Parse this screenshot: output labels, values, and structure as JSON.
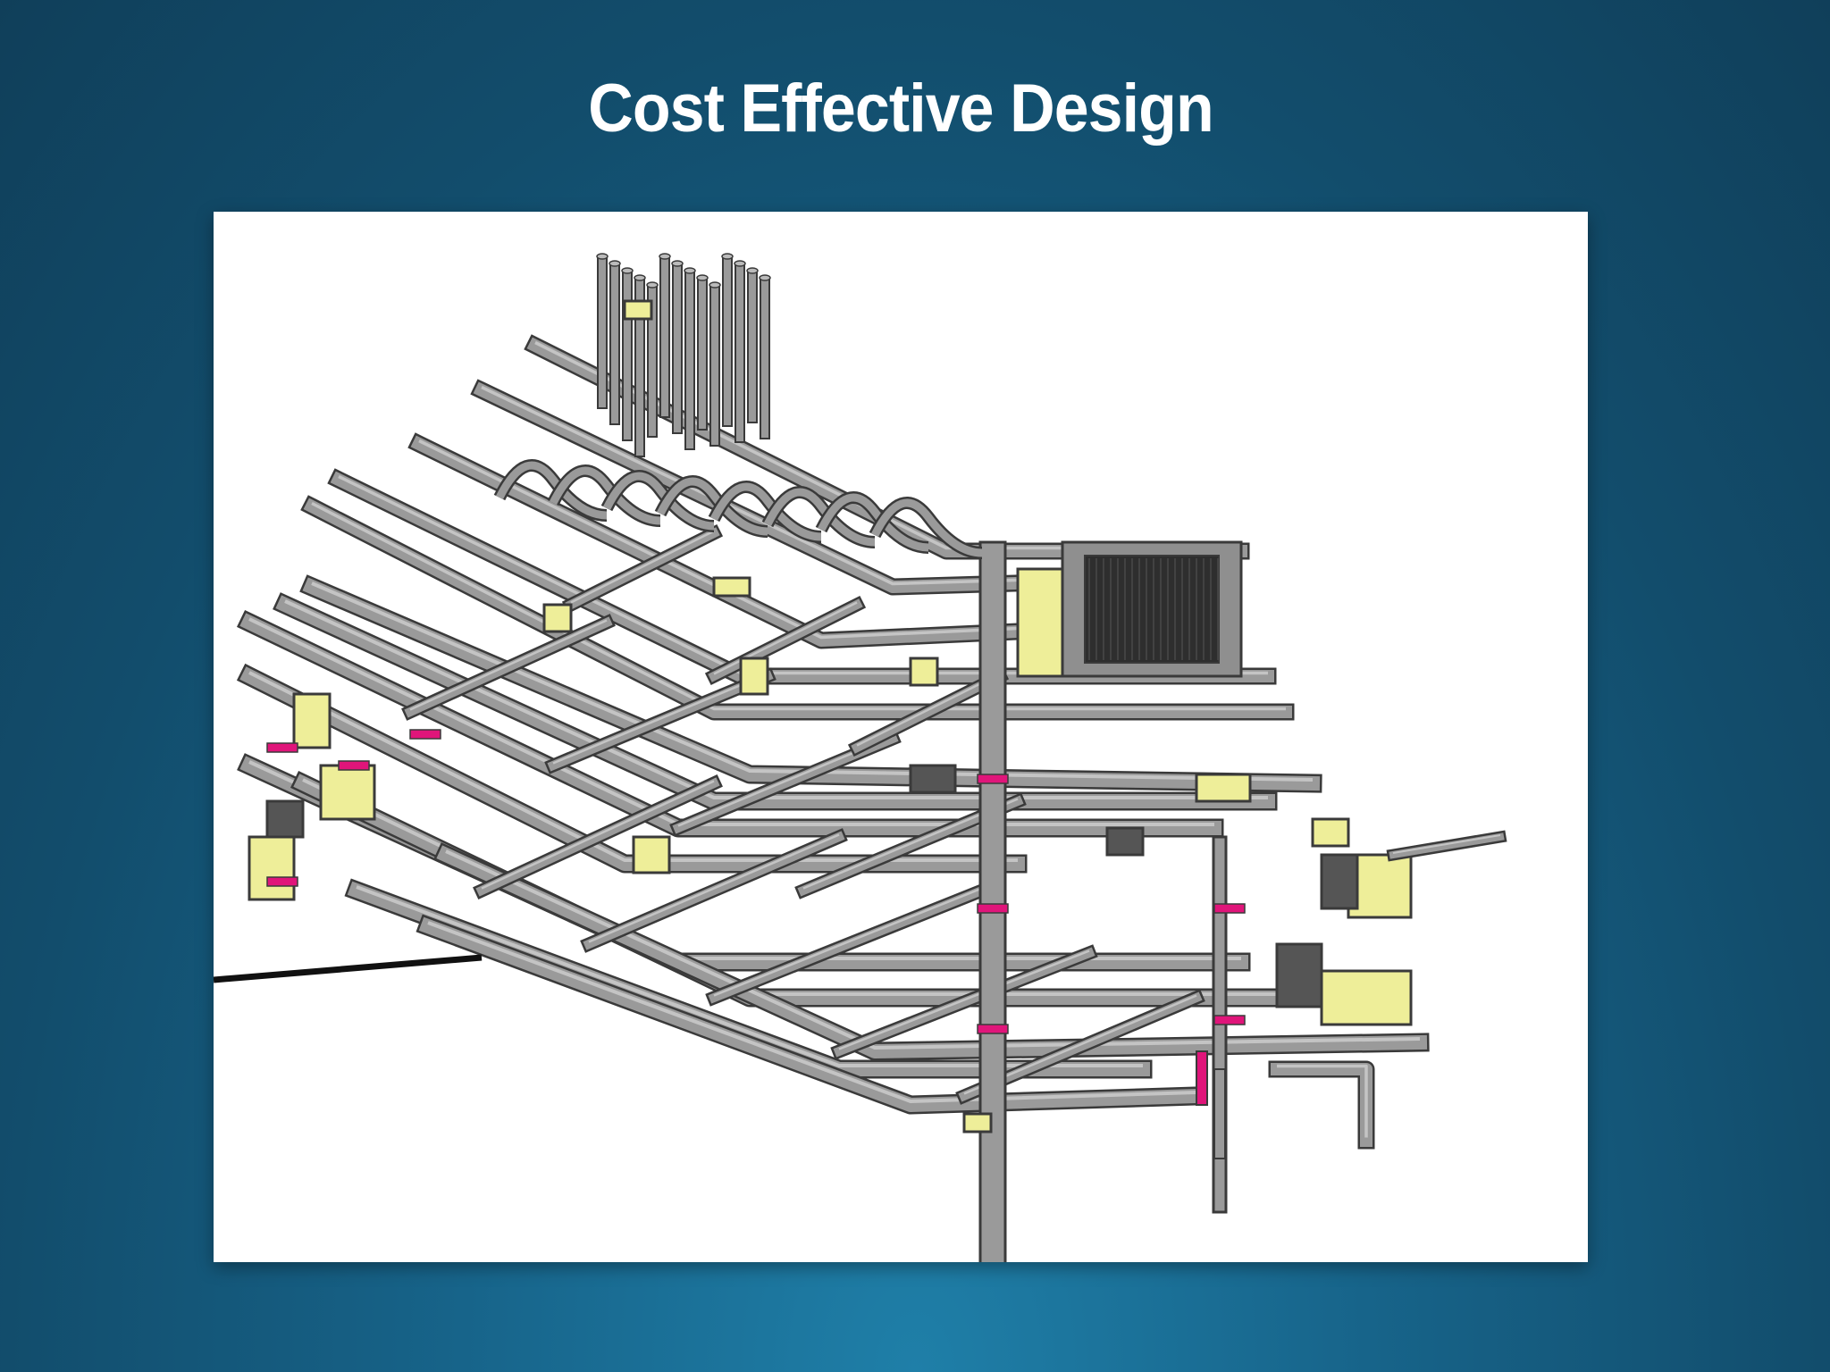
{
  "slide": {
    "title": "Cost Effective Design"
  },
  "figure": {
    "kind": "3D isometric model of building ductwork and piping systems",
    "colors": {
      "duct": "#9a9a9a",
      "duct_edge": "#3a3a3a",
      "equipment": "#eeee99",
      "connector": "#e0157a",
      "background": "#ffffff",
      "slide_background": "#17648a"
    }
  }
}
